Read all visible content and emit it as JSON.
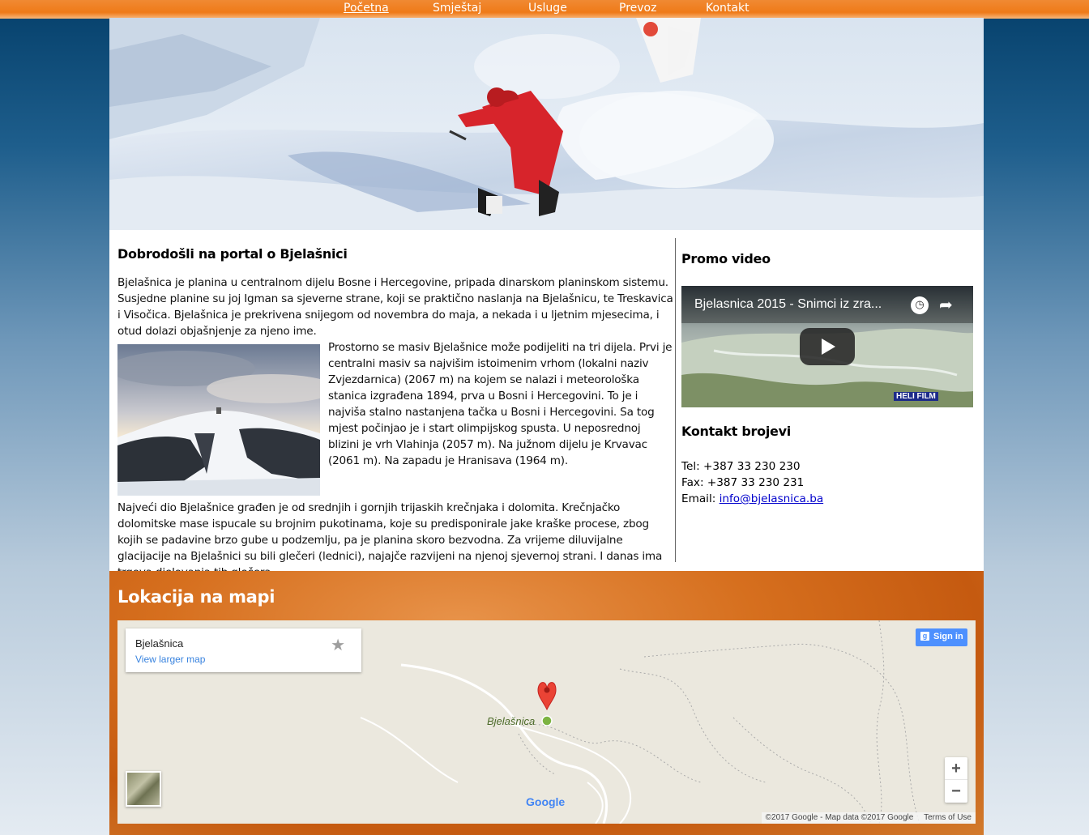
{
  "nav": {
    "items": [
      {
        "label": "Početna",
        "active": true
      },
      {
        "label": "Smještaj"
      },
      {
        "label": "Usluge"
      },
      {
        "label": "Prevoz"
      },
      {
        "label": "Kontakt"
      }
    ]
  },
  "main": {
    "title": "Dobrodošli na portal o Bjelašnici",
    "para1": "Bjelašnica je planina u centralnom dijelu Bosne i Hercegovine, pripada dinarskom planinskom sistemu. Susjedne planine su joj Igman sa sjeverne strane, koji se praktično naslanja na Bjelašnicu, te Treskavica i Visočica. Bjelašnica je prekrivena snijegom od novembra do maja, a nekada i u ljetnim mjesecima, i otud dolazi objašnjenje za njeno ime.",
    "para2": "Prostorno se masiv Bjelašnice može podijeliti na tri dijela. Prvi je centralni masiv sa najvišim istoimenim vrhom (lokalni naziv Zvjezdarnica) (2067 m) na kojem se nalazi i meteorološka stanica izgrađena 1894, prva u Bosni i Hercegovini. To je i najviša stalno nastanjena tačka u Bosni i Hercegovini. Sa tog mjest počinjao je i start olimpijskog spusta. U neposrednoj blizini je vrh Vlahinja (2057 m). Na južnom dijelu je Krvavac (2061 m). Na zapadu je Hranisava (1964 m).",
    "para3": "Najveći dio Bjelašnice građen je od srednjih i gornjih trijaskih krečnjaka i dolomita. Krečnjačko dolomitske mase ispucale su brojnim pukotinama, koje su predisponirale jake kraške procese, zbog kojih se padavine brzo gube u podzemlju, pa je planina skoro bezvodna. Za vrijeme diluvijalne glacijacije na Bjelašnici su bili glečeri (lednici), najajče razvijeni na njenoj sjevernoj strani. I danas ima trgova djelovanja tih glečera."
  },
  "sidebar": {
    "video_heading": "Promo video",
    "video_title": "Bjelasnica 2015 - Snimci iz zra...",
    "video_watermark": "HELI FILM",
    "contact_heading": "Kontakt brojevi",
    "tel": "Tel: +387 33 230 230",
    "fax": "Fax: +387 33 230 231",
    "email_label": "Email: ",
    "email": "info@bjelasnica.ba"
  },
  "map": {
    "heading": "Lokacija na mapi",
    "place_name": "Bjelašnica",
    "larger_map": "View larger map",
    "sign_in": "Sign in",
    "pin_label": "Bjelašnica",
    "zoom_in": "+",
    "zoom_out": "−",
    "attribution": "©2017 Google - Map data ©2017 Google",
    "terms": "Terms of Use",
    "google_logo": "Google"
  },
  "colors": {
    "nav_orange": "#ef7a18",
    "map_section": "#d66f1e",
    "link_blue": "#0000cc"
  }
}
